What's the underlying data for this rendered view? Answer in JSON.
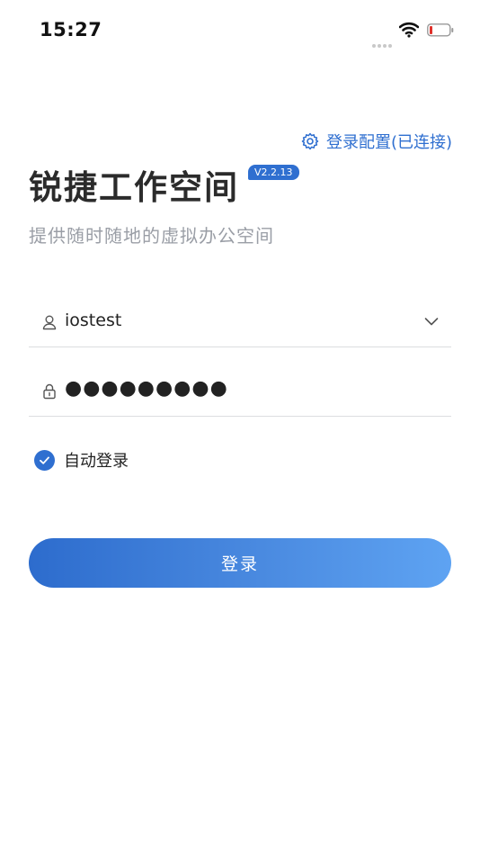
{
  "status_bar": {
    "time": "15:27"
  },
  "header": {
    "config_link": "登录配置(已连接)",
    "title": "锐捷工作空间",
    "version": "V2.2.13",
    "subtitle": "提供随时随地的虚拟办公空间"
  },
  "form": {
    "username_value": "iostest",
    "password_value": "●●●●●●●●●",
    "auto_login_label": "自动登录",
    "auto_login_checked": true,
    "login_button": "登录"
  },
  "colors": {
    "accent": "#2f6fd0",
    "gradient_end": "#5ea3f2",
    "muted_text": "#9a9ea6"
  },
  "icons": [
    "gear-icon",
    "user-icon",
    "lock-icon",
    "chevron-down-icon",
    "check-icon",
    "wifi-icon",
    "battery-icon"
  ]
}
